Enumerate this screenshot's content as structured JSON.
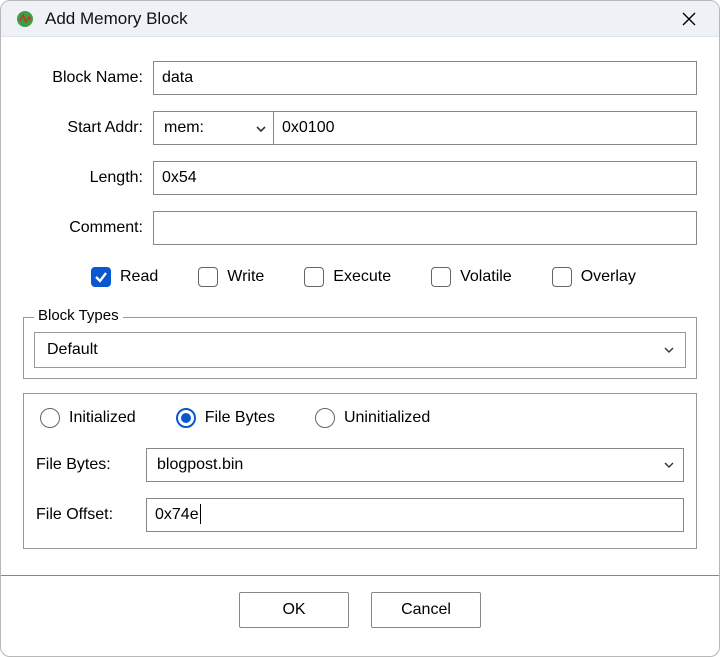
{
  "window": {
    "title": "Add Memory Block"
  },
  "labels": {
    "block_name": "Block Name:",
    "start_addr": "Start Addr:",
    "length": "Length:",
    "comment": "Comment:",
    "file_bytes": "File Bytes:",
    "file_offset": "File Offset:"
  },
  "fields": {
    "block_name": "data",
    "addr_space": "mem:",
    "start_addr": "0x0100",
    "length": "0x54",
    "comment": "",
    "block_type": "Default",
    "file_bytes": "blogpost.bin",
    "file_offset": "0x74e"
  },
  "flags": {
    "read": {
      "label": "Read",
      "checked": true
    },
    "write": {
      "label": "Write",
      "checked": false
    },
    "execute": {
      "label": "Execute",
      "checked": false
    },
    "volatile": {
      "label": "Volatile",
      "checked": false
    },
    "overlay": {
      "label": "Overlay",
      "checked": false
    }
  },
  "block_types_legend": "Block Types",
  "init_mode": {
    "initialized": {
      "label": "Initialized",
      "selected": false
    },
    "file_bytes": {
      "label": "File Bytes",
      "selected": true
    },
    "uninitialized": {
      "label": "Uninitialized",
      "selected": false
    }
  },
  "buttons": {
    "ok": "OK",
    "cancel": "Cancel"
  }
}
